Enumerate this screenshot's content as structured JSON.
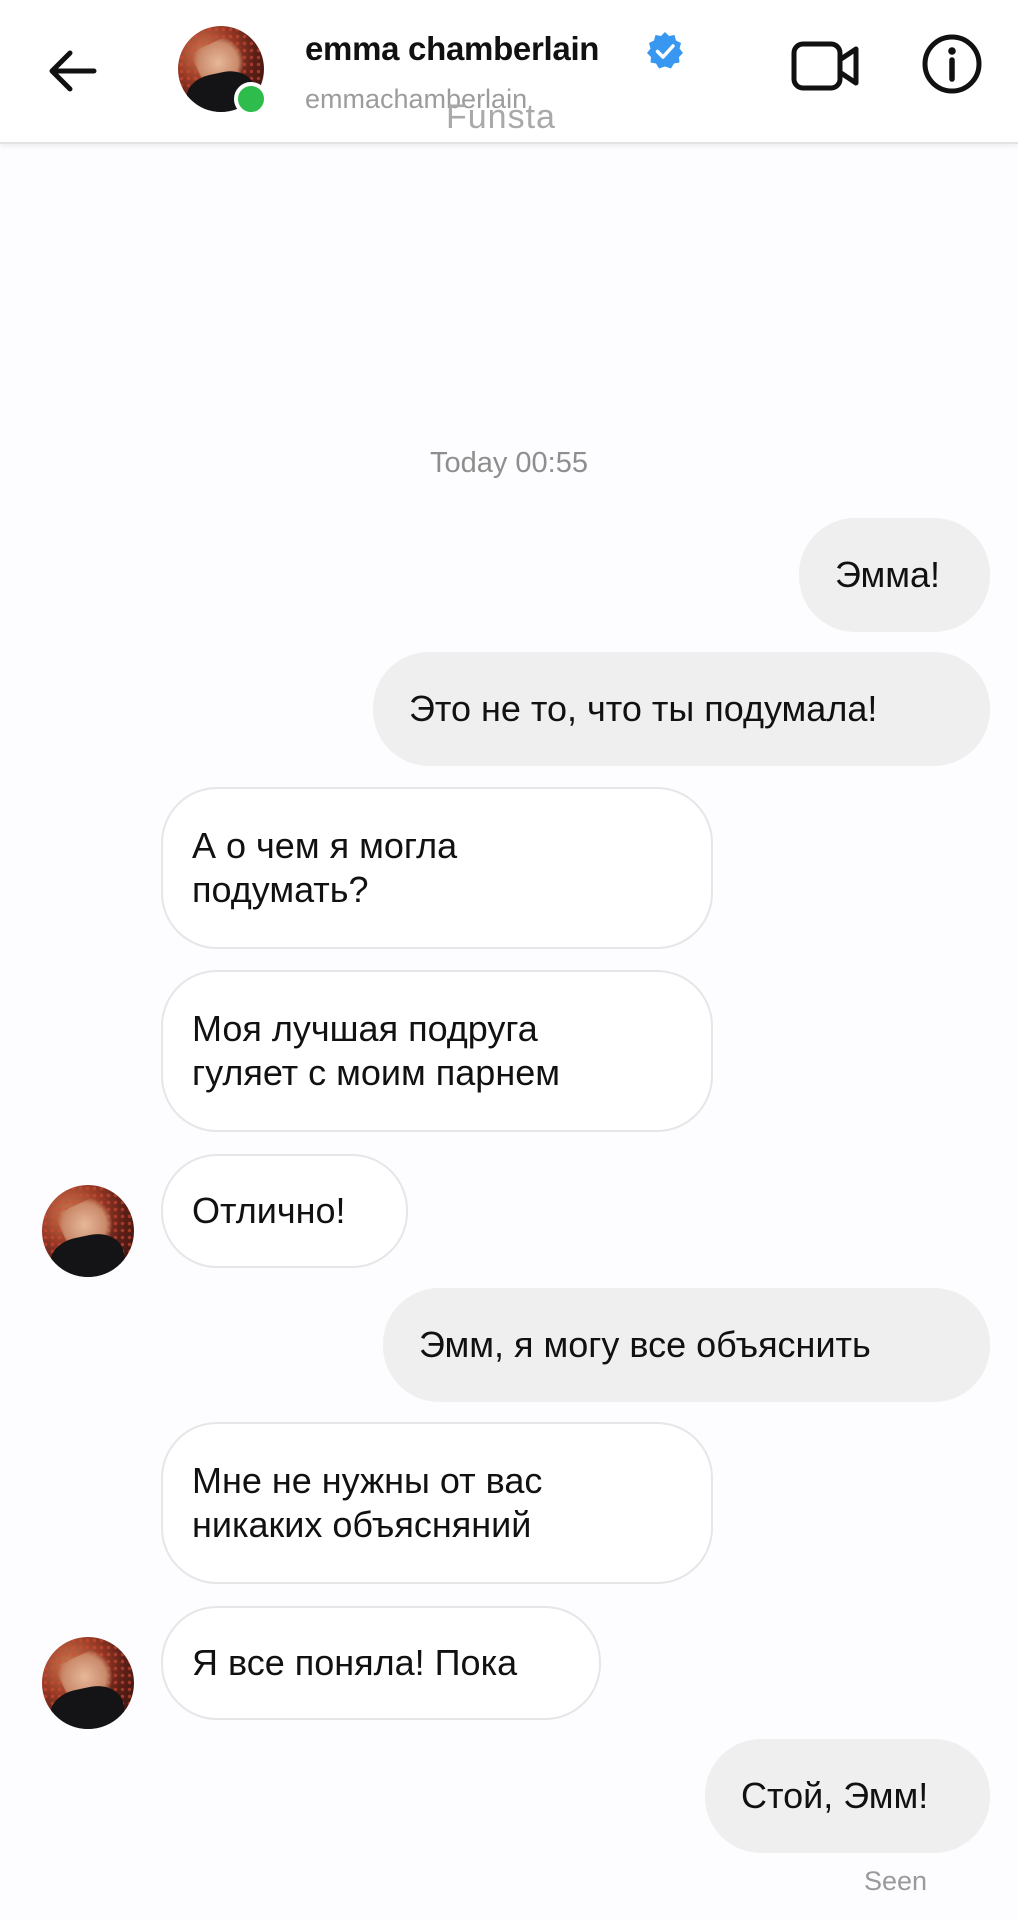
{
  "header": {
    "name": "emma chamberlain",
    "username": "emmachamberlain",
    "watermark": "Funsta"
  },
  "chat": {
    "timestamp": "Today 00:55",
    "messages": [
      {
        "from": "me",
        "text": "Эмма!"
      },
      {
        "from": "me",
        "text": "Это не то, что ты подумала!"
      },
      {
        "from": "them",
        "lines": [
          "А о чем я могла",
          "подумать?"
        ]
      },
      {
        "from": "them",
        "lines": [
          "Моя лучшая подруга",
          "гуляет с моим парнем"
        ]
      },
      {
        "from": "them",
        "text": "Отлично!"
      },
      {
        "from": "me",
        "text": "Эмм, я могу все объяснить"
      },
      {
        "from": "them",
        "lines": [
          "Мне не нужны от вас",
          "никаких объясняний"
        ]
      },
      {
        "from": "them",
        "text": "Я все поняла! Пока"
      },
      {
        "from": "me",
        "text": "Стой, Эмм!"
      }
    ],
    "seen": "Seen"
  },
  "colors": {
    "verified": "#3897f0",
    "online": "#2ebd4d",
    "sent_bubble": "#efefef",
    "received_bubble": "#ffffff"
  }
}
